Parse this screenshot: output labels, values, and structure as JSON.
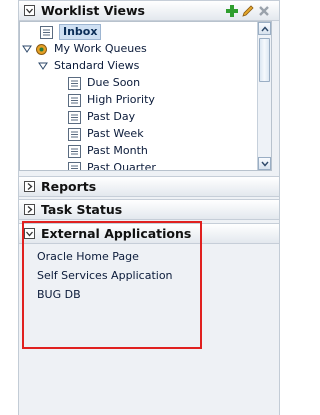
{
  "worklist": {
    "title": "Worklist Views",
    "tree": [
      {
        "label": "Inbox",
        "selected": true
      },
      {
        "label": "My Work Queues"
      },
      {
        "label": "Standard Views"
      },
      {
        "label": "Due Soon"
      },
      {
        "label": "High Priority"
      },
      {
        "label": "Past Day"
      },
      {
        "label": "Past Week"
      },
      {
        "label": "Past Month"
      },
      {
        "label": "Past Quarter"
      }
    ],
    "tools": [
      "add-icon",
      "edit-pencil-icon",
      "delete-x-icon"
    ]
  },
  "reports": {
    "title": "Reports"
  },
  "task_status": {
    "title": "Task Status"
  },
  "external_apps": {
    "title": "External Applications",
    "links": [
      "Oracle Home Page",
      "Self Services Application",
      "BUG DB"
    ]
  },
  "colors": {
    "highlight": "#e0201f",
    "selected_bg": "#cfe0f3",
    "panel_bg": "#eef1f5"
  }
}
